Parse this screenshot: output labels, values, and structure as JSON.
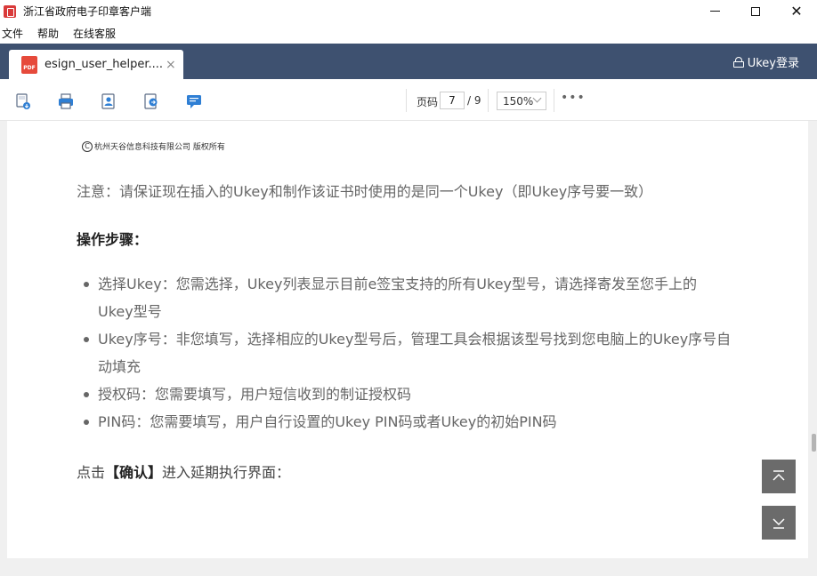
{
  "window": {
    "title": "浙江省政府电子印章客户端"
  },
  "menu": {
    "items": [
      "文件",
      "帮助",
      "在线客服"
    ]
  },
  "tabs": {
    "active_label": "esign_user_helper....",
    "pdf_badge": "PDF",
    "close_glyph": "×",
    "ukey_login_label": "Ukey登录"
  },
  "toolbar": {
    "page_label": "页码",
    "current_page": "7",
    "total_pages": "/ 9",
    "zoom": "150%",
    "more_glyph": "•••",
    "icons": [
      "save-icon",
      "print-icon",
      "user-cert-icon",
      "share-document-icon",
      "comment-icon"
    ]
  },
  "document": {
    "copyright_symbol": "C",
    "copyright_text": "杭州天谷信息科技有限公司 版权所有",
    "note": "注意：请保证现在插入的Ukey和制作该证书时使用的是同一个Ukey（即Ukey序号要一致）",
    "steps_title": "操作步骤：",
    "steps": [
      "选择Ukey：您需选择，Ukey列表显示目前e签宝支持的所有Ukey型号，请选择寄发至您手上的Ukey型号",
      "Ukey序号：非您填写，选择相应的Ukey型号后，管理工具会根据该型号找到您电脑上的Ukey序号自动填充",
      "授权码：您需要填写，用户短信收到的制证授权码",
      "PIN码：您需要填写，用户自行设置的Ukey PIN码或者Ukey的初始PIN码"
    ],
    "confirm_prefix": "点击",
    "confirm_bold": "【确认】",
    "confirm_suffix": "进入延期执行界面："
  },
  "colors": {
    "tabbar_bg": "#3e5170",
    "pdf_icon": "#e64a3b",
    "toolbar_icon": "#2f7fd4",
    "scroll_btn": "#6b6b6b"
  }
}
